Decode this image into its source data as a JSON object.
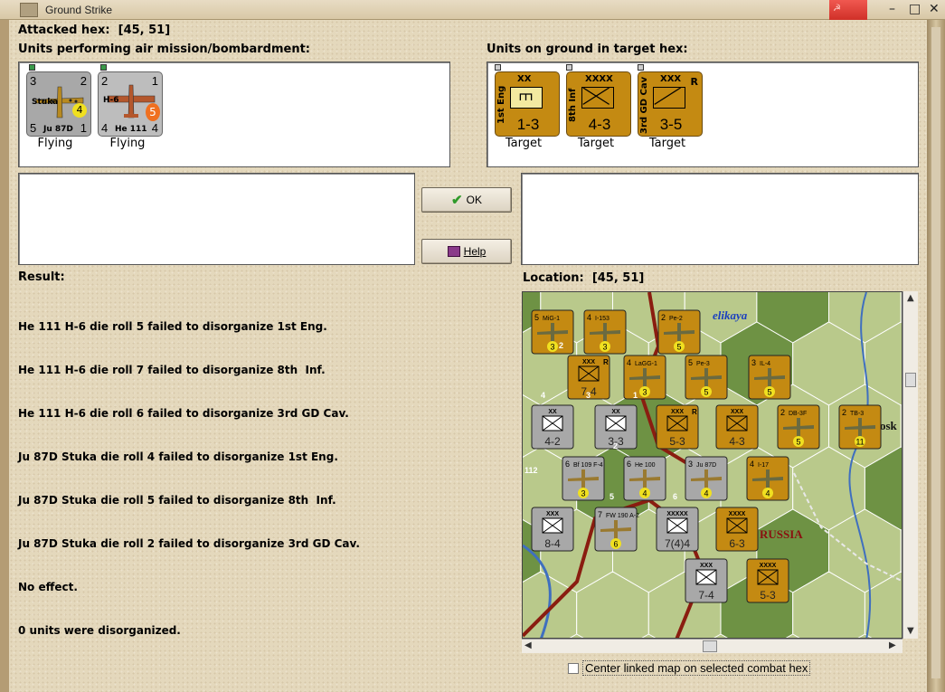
{
  "window": {
    "title": "Ground Strike"
  },
  "attacked_hex": {
    "label": "Attacked hex:",
    "value": "[45, 51]"
  },
  "air_units": {
    "heading": "Units performing air mission/bombardment:",
    "units": [
      {
        "name": "Stuka",
        "type": "Ju 87D",
        "tl": "3",
        "tr": "2",
        "bl": "5",
        "br": "1",
        "badge": "4",
        "status": "Flying"
      },
      {
        "name": "H-6",
        "type": "He 111",
        "tl": "2",
        "tr": "1",
        "bl": "4",
        "br": "4",
        "badge": "5",
        "status": "Flying"
      }
    ]
  },
  "ground_units": {
    "heading": "Units on ground in target hex:",
    "units": [
      {
        "name": "1st Eng",
        "size": "XX",
        "strength": "1-3",
        "flag": "",
        "status": "Target"
      },
      {
        "name": "8th Inf",
        "size": "XXXX",
        "strength": "4-3",
        "flag": "",
        "status": "Target"
      },
      {
        "name": "3rd GD Cav",
        "size": "XXX",
        "strength": "3-5",
        "flag": "R",
        "status": "Target"
      }
    ]
  },
  "buttons": {
    "ok": "OK",
    "help": "Help"
  },
  "result": {
    "label": "Result:",
    "lines": [
      "He 111 H-6 die roll 5 failed to disorganize 1st Eng.",
      "He 111 H-6 die roll 7 failed to disorganize 8th  Inf.",
      "He 111 H-6 die roll 6 failed to disorganize 3rd GD Cav.",
      "Ju 87D Stuka die roll 4 failed to disorganize 1st Eng.",
      "Ju 87D Stuka die roll 5 failed to disorganize 8th  Inf.",
      "Ju 87D Stuka die roll 2 failed to disorganize 3rd GD Cav.",
      "No effect.",
      "0 units were disorganized."
    ]
  },
  "location": {
    "label": "Location:",
    "value": "[45, 51]"
  },
  "map": {
    "place_labels": [
      "elikaya",
      "RUSSIA",
      "osk"
    ],
    "counters": [
      {
        "kind": "air-sov",
        "tl": "5",
        "name": "MiG-1",
        "badge": "3"
      },
      {
        "kind": "air-sov",
        "tl": "4",
        "name": "I-153",
        "badge": "3"
      },
      {
        "kind": "air-sov",
        "tl": "2",
        "name": "Pe-2",
        "badge": "5"
      },
      {
        "kind": "air-sov",
        "tl": "4",
        "name": "LaGG-1",
        "badge": "3"
      },
      {
        "kind": "air-sov",
        "tl": "5",
        "name": "Pe-3",
        "badge": "5"
      },
      {
        "kind": "air-sov",
        "tl": "3",
        "name": "IL-4",
        "badge": "5"
      },
      {
        "kind": "gnd-sov",
        "str": "7-4",
        "size": "XXX",
        "flag": "R"
      },
      {
        "kind": "gnd-ax",
        "str": "4-2",
        "size": "XX"
      },
      {
        "kind": "gnd-ax",
        "str": "3-3",
        "size": "XX"
      },
      {
        "kind": "gnd-sov",
        "str": "5-3",
        "size": "XXX",
        "flag": "R"
      },
      {
        "kind": "gnd-sov",
        "str": "4-3",
        "size": "XXX"
      },
      {
        "kind": "air-sov",
        "tl": "2",
        "name": "DB-3F",
        "badge": "5"
      },
      {
        "kind": "air-sov",
        "tl": "2",
        "name": "TB-3",
        "badge": "11"
      },
      {
        "kind": "air-ax",
        "tl": "6",
        "name": "Bf 109 F-4",
        "badge": "3"
      },
      {
        "kind": "air-ax",
        "tl": "6",
        "name": "He 100",
        "badge": "4"
      },
      {
        "kind": "air-ax",
        "tl": "3",
        "name": "Ju 87D",
        "badge": "4"
      },
      {
        "kind": "air-sov",
        "tl": "4",
        "name": "I-17",
        "badge": "4"
      },
      {
        "kind": "gnd-ax",
        "str": "8-4",
        "size": "XXX"
      },
      {
        "kind": "air-ax",
        "tl": "7",
        "name": "FW 190 A-2",
        "badge": "6"
      },
      {
        "kind": "gnd-ax",
        "str": "7(4)4",
        "size": "XXXXX"
      },
      {
        "kind": "gnd-sov",
        "str": "6-3",
        "size": "XXXX"
      },
      {
        "kind": "gnd-ax",
        "str": "7-4",
        "size": "XXX"
      },
      {
        "kind": "gnd-sov",
        "str": "5-3",
        "size": "XXXX"
      }
    ],
    "edge_numbers": [
      "112",
      "2",
      "1",
      "2",
      "3",
      "4",
      "5",
      "6"
    ]
  },
  "center_map": {
    "label": "Center linked map on selected combat hex",
    "checked": false
  },
  "colors": {
    "axis_counter": "#a8a8a8",
    "soviet_counter": "#c48a12",
    "parchment": "#e4d8bc",
    "map_terrain": "#b9c98b",
    "forest": "#6e9244",
    "border": "#8a1d10"
  }
}
